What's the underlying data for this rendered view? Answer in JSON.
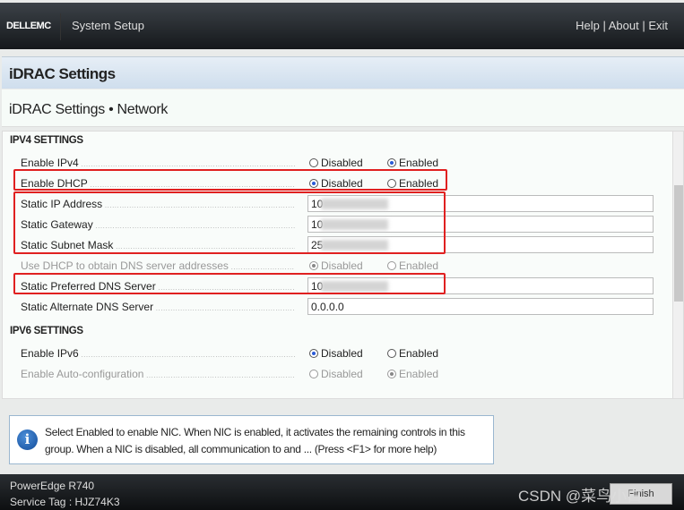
{
  "header": {
    "logo": "DELLEMC",
    "title": "System Setup",
    "links": [
      "Help",
      "About",
      "Exit"
    ],
    "link_sep": " | "
  },
  "page_title": "iDRAC Settings",
  "subtitle": "iDRAC Settings • Network",
  "ipv4": {
    "heading": "IPV4 SETTINGS",
    "enable_ipv4": {
      "label": "Enable IPv4",
      "options": [
        "Disabled",
        "Enabled"
      ],
      "selected": "Enabled"
    },
    "enable_dhcp": {
      "label": "Enable DHCP",
      "options": [
        "Disabled",
        "Enabled"
      ],
      "selected": "Disabled"
    },
    "static_ip": {
      "label": "Static IP Address",
      "value": "10"
    },
    "static_gateway": {
      "label": "Static Gateway",
      "value": "10"
    },
    "static_subnet": {
      "label": "Static Subnet Mask",
      "value": "25"
    },
    "dhcp_dns": {
      "label": "Use DHCP to obtain DNS server addresses",
      "options": [
        "Disabled",
        "Enabled"
      ],
      "selected": "Disabled",
      "disabled": true
    },
    "preferred_dns": {
      "label": "Static Preferred DNS Server",
      "value": "10"
    },
    "alternate_dns": {
      "label": "Static Alternate DNS Server",
      "value": "0.0.0.0"
    }
  },
  "ipv6": {
    "heading": "IPV6 SETTINGS",
    "enable_ipv6": {
      "label": "Enable IPv6",
      "options": [
        "Disabled",
        "Enabled"
      ],
      "selected": "Disabled"
    },
    "auto_config": {
      "label": "Enable Auto-configuration",
      "options": [
        "Disabled",
        "Enabled"
      ],
      "selected": "Enabled",
      "disabled": true
    }
  },
  "help": {
    "text": "Select Enabled to enable NIC. When NIC is enabled, it activates the remaining controls in this group. When a NIC is disabled, all communication to and ... (Press <F1> for more help)"
  },
  "footer": {
    "model": "PowerEdge R740",
    "service_tag": "Service Tag : HJZ74K3",
    "finish": "Finish",
    "watermark": "CSDN @菜鸟小白"
  },
  "colors": {
    "highlight_box": "#e02020",
    "radio_selected": "#2a5bd6",
    "header_bg": "#1e2226"
  }
}
